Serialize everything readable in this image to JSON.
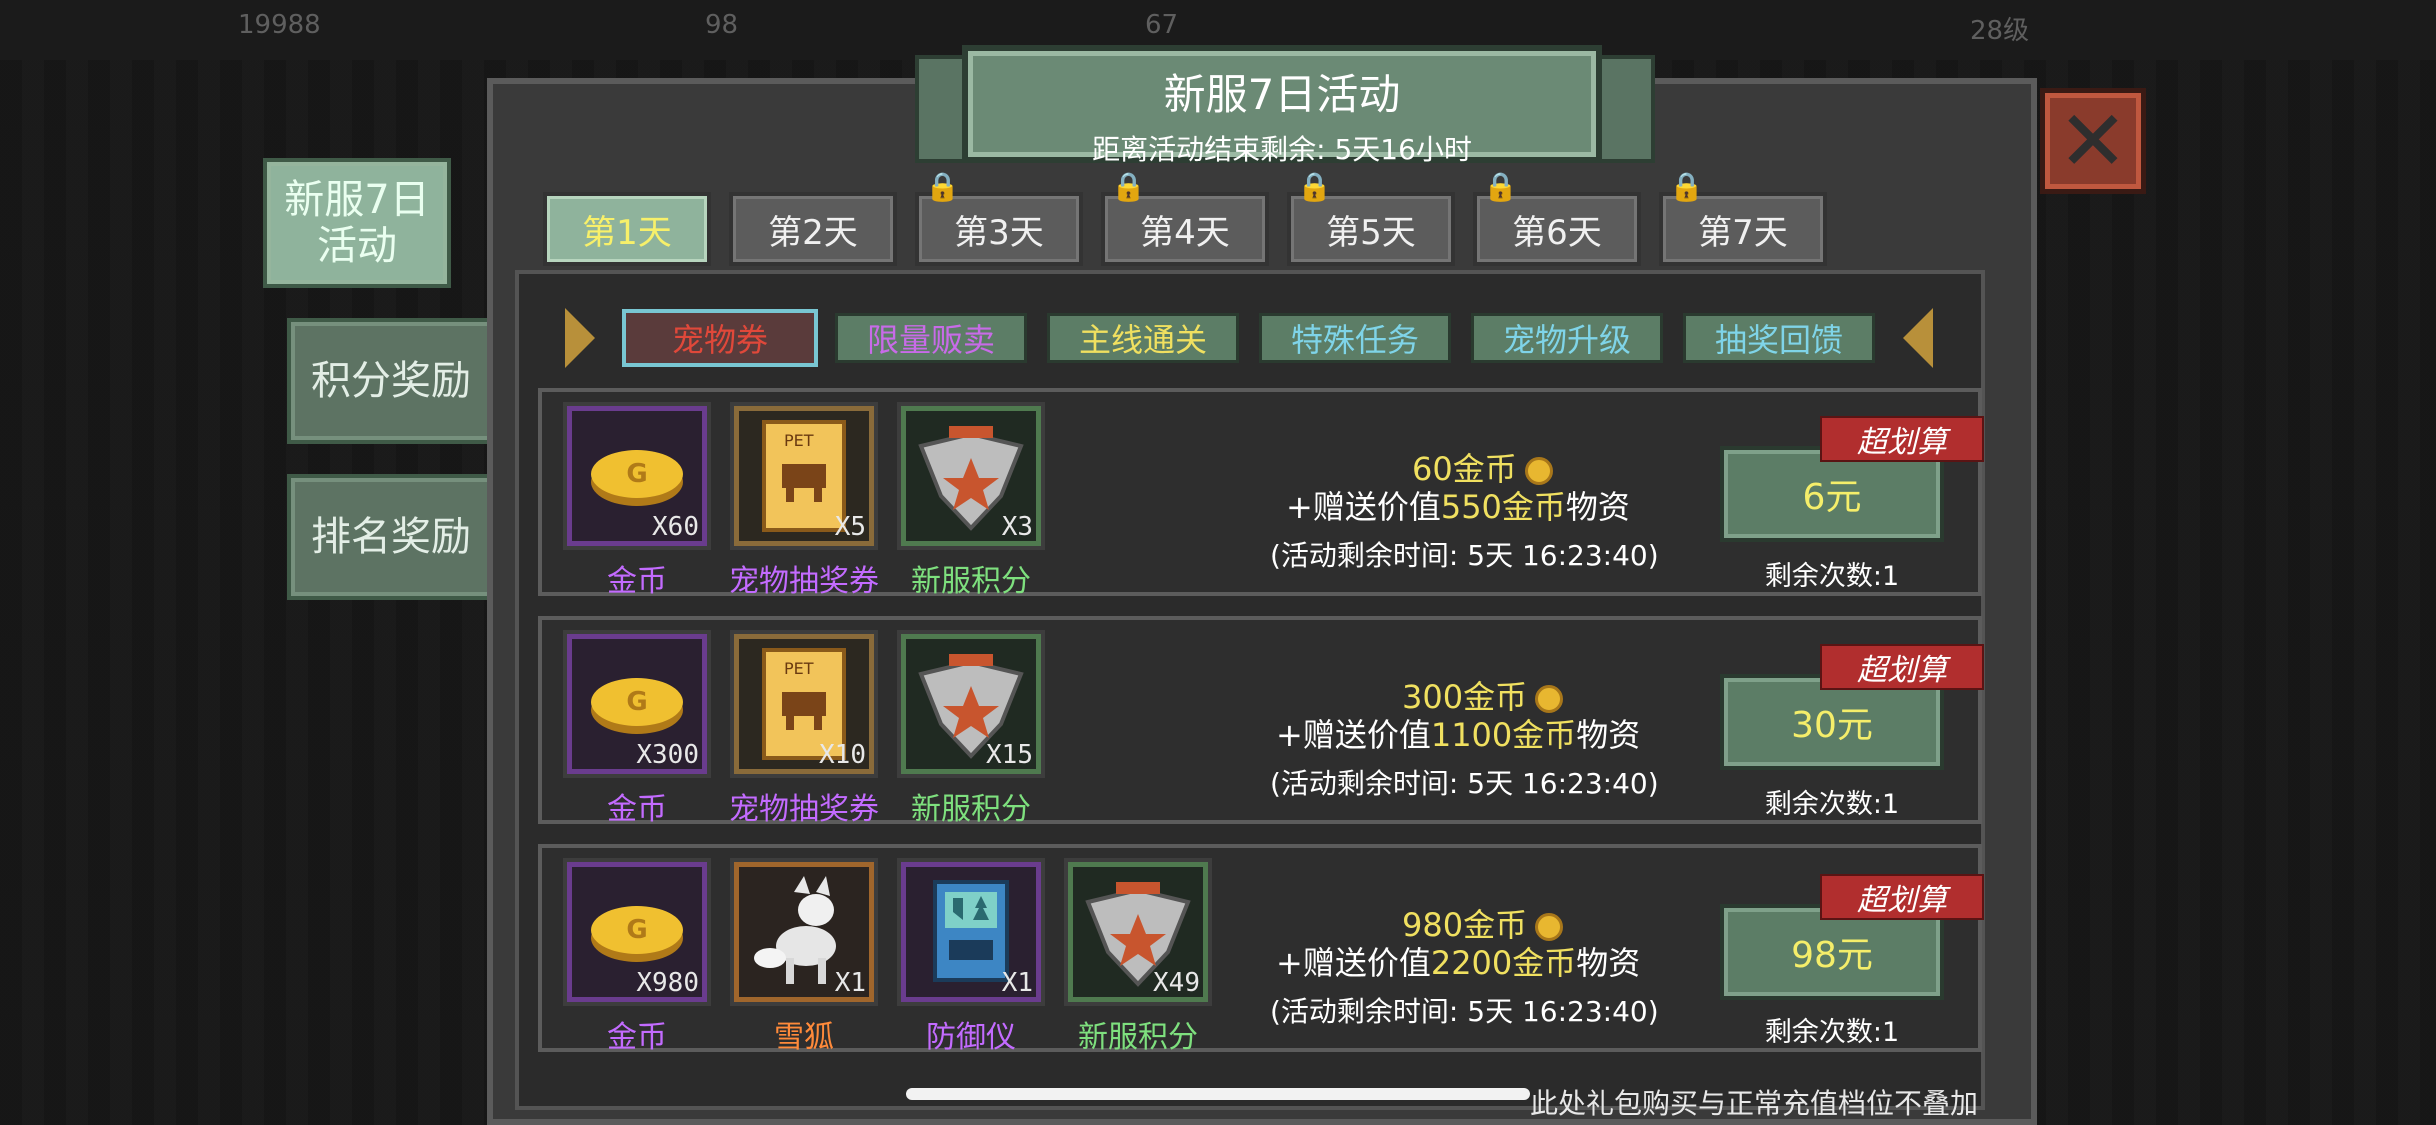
{
  "background_hud": {
    "left": "19988",
    "mid1": "98",
    "mid2": "67",
    "right": "28级"
  },
  "title": {
    "main": "新服7日活动",
    "sub": "距离活动结束剩余: 5天16小时"
  },
  "close_label": "✕",
  "side_tabs": [
    {
      "label_l1": "新服7日",
      "label_l2": "活动"
    },
    {
      "label": "积分奖励"
    },
    {
      "label": "排名奖励"
    }
  ],
  "day_tabs": [
    "第1天",
    "第2天",
    "第3天",
    "第4天",
    "第5天",
    "第6天",
    "第7天"
  ],
  "categories": [
    {
      "label": "宠物券",
      "color": "#e0483a"
    },
    {
      "label": "限量贩卖",
      "color": "#c86be8"
    },
    {
      "label": "主线通关",
      "color": "#f0e060"
    },
    {
      "label": "特殊任务",
      "color": "#7fd4e8"
    },
    {
      "label": "宠物升级",
      "color": "#7fd4e8"
    },
    {
      "label": "抽奖回馈",
      "color": "#7fd4e8"
    }
  ],
  "offers": [
    {
      "items": [
        {
          "name": "金币",
          "qty": "X60",
          "icon": "gold-coin-icon"
        },
        {
          "name": "宠物抽奖券",
          "qty": "X5",
          "icon": "pet-ticket-icon"
        },
        {
          "name": "新服积分",
          "qty": "X3",
          "icon": "server-points-badge-icon"
        }
      ],
      "coins": "60金币",
      "bonus_prefix": "+赠送价值",
      "bonus_value": "550金币",
      "bonus_suffix": "物资",
      "timer": "(活动剩余时间: 5天 16:23:40)",
      "price": "6元",
      "deal": "超划算",
      "remaining": "剩余次数:1"
    },
    {
      "items": [
        {
          "name": "金币",
          "qty": "X300",
          "icon": "gold-coin-icon"
        },
        {
          "name": "宠物抽奖券",
          "qty": "X10",
          "icon": "pet-ticket-icon"
        },
        {
          "name": "新服积分",
          "qty": "X15",
          "icon": "server-points-badge-icon"
        }
      ],
      "coins": "300金币",
      "bonus_prefix": "+赠送价值",
      "bonus_value": "1100金币",
      "bonus_suffix": "物资",
      "timer": "(活动剩余时间: 5天 16:23:40)",
      "price": "30元",
      "deal": "超划算",
      "remaining": "剩余次数:1"
    },
    {
      "items": [
        {
          "name": "金币",
          "qty": "X980",
          "icon": "gold-coin-icon"
        },
        {
          "name": "雪狐",
          "qty": "X1",
          "icon": "snow-fox-icon"
        },
        {
          "name": "防御仪",
          "qty": "X1",
          "icon": "defense-device-icon"
        },
        {
          "name": "新服积分",
          "qty": "X49",
          "icon": "server-points-badge-icon"
        }
      ],
      "coins": "980金币",
      "bonus_prefix": "+赠送价值",
      "bonus_value": "2200金币",
      "bonus_suffix": "物资",
      "timer": "(活动剩余时间: 5天 16:23:40)",
      "price": "98元",
      "deal": "超划算",
      "remaining": "剩余次数:1"
    }
  ],
  "footer_note": "此处礼包购买与正常充值档位不叠加"
}
